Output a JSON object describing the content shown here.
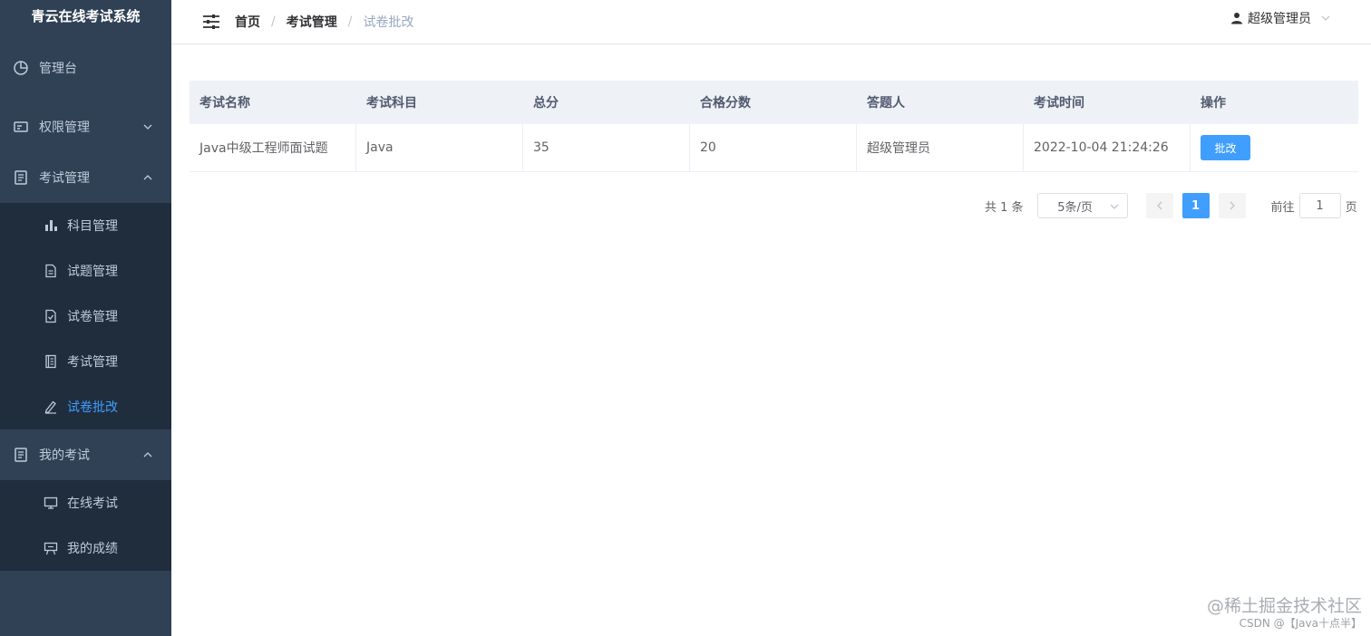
{
  "app": {
    "title": "青云在线考试系统"
  },
  "sidebar": {
    "items": [
      {
        "label": "管理台"
      },
      {
        "label": "权限管理"
      },
      {
        "label": "考试管理",
        "children": [
          {
            "label": "科目管理"
          },
          {
            "label": "试题管理"
          },
          {
            "label": "试卷管理"
          },
          {
            "label": "考试管理"
          },
          {
            "label": "试卷批改"
          }
        ]
      },
      {
        "label": "我的考试",
        "children": [
          {
            "label": "在线考试"
          },
          {
            "label": "我的成绩"
          }
        ]
      }
    ]
  },
  "header": {
    "breadcrumb": [
      "首页",
      "考试管理",
      "试卷批改"
    ],
    "separator": "/",
    "user": "超级管理员"
  },
  "table": {
    "columns": [
      "考试名称",
      "考试科目",
      "总分",
      "合格分数",
      "答题人",
      "考试时间",
      "操作"
    ],
    "rows": [
      [
        "Java中级工程师面试题",
        "Java",
        "35",
        "20",
        "超级管理员",
        "2022-10-04 21:24:26",
        "批改"
      ]
    ]
  },
  "pagination": {
    "total": "共 1 条",
    "page_size": "5条/页",
    "current": "1",
    "goto_prefix": "前往",
    "goto_value": "1",
    "goto_suffix": "页"
  },
  "watermark": {
    "line1": "@稀土掘金技术社区",
    "line2": "CSDN @【Java十点半】"
  },
  "colors": {
    "sidebar": "#304156",
    "submenu": "#1f2d3d",
    "accent": "#409eff"
  }
}
